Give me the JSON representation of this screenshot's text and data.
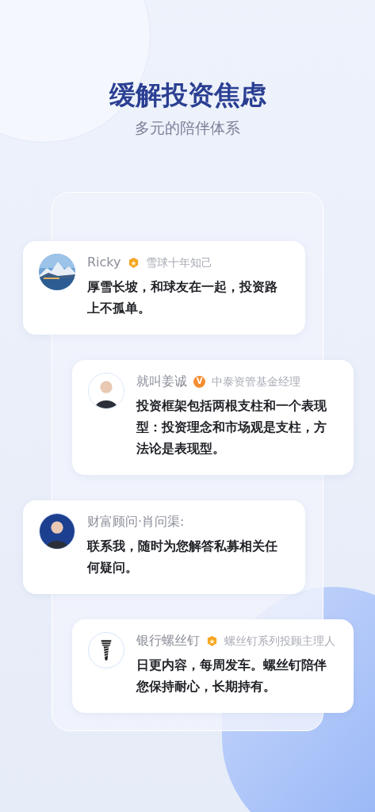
{
  "header": {
    "title": "缓解投资焦虑",
    "subtitle": "多元的陪伴体系"
  },
  "cards": [
    {
      "name": "Ricky",
      "badge": {
        "kind": "medal"
      },
      "role": "雪球十年知己",
      "text": "厚雪长坡，和球友在一起，投资路上不孤单。"
    },
    {
      "avatar": {
        "kind": "person",
        "color": "#ffffff"
      },
      "name": "就叫姜诚",
      "badge": {
        "kind": "verified",
        "label": "V"
      },
      "role": "中泰资管基金经理",
      "text": "投资框架包括两根支柱和一个表现型：投资理念和市场观是支柱，方法论是表现型。"
    },
    {
      "avatar": {
        "kind": "person",
        "color": "#1d3f8f"
      },
      "name": "财富顾问·肖问渠:",
      "text": "联系我，随时为您解答私募相关任何疑问。"
    },
    {
      "avatar": {
        "kind": "screw"
      },
      "name": "银行螺丝钉",
      "badge": {
        "kind": "medal"
      },
      "role": "螺丝钉系列投顾主理人",
      "text": "日更内容，每周发车。螺丝钉陪伴您保持耐心，长期持有。"
    }
  ]
}
